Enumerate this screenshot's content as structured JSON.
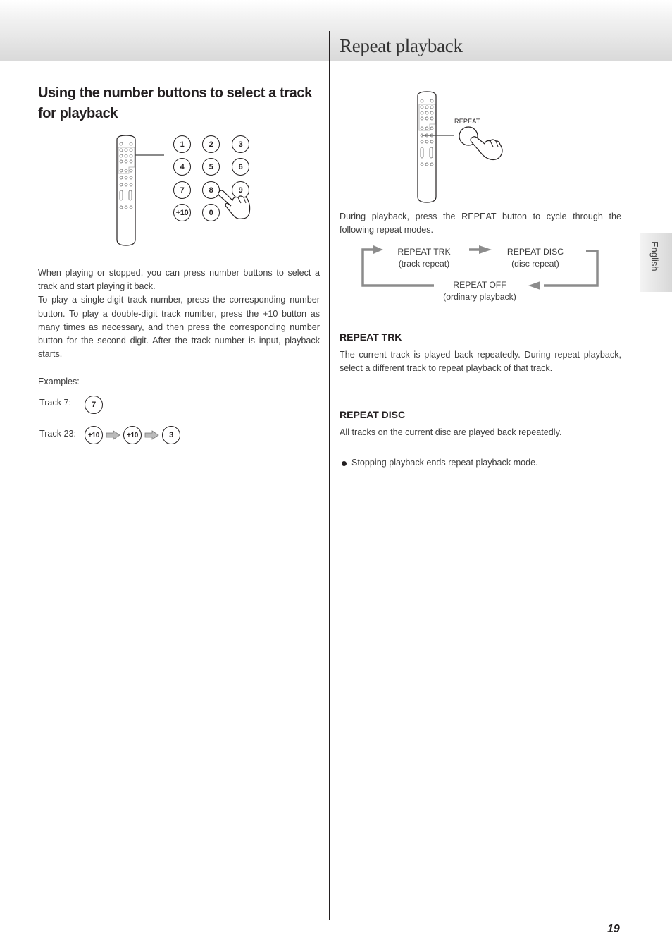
{
  "page": {
    "title": "Repeat playback",
    "page_number": "19",
    "language_tab": "English"
  },
  "left": {
    "heading": "Using the number buttons to select a track for playback",
    "keypad": [
      "1",
      "2",
      "3",
      "4",
      "5",
      "6",
      "7",
      "8",
      "9",
      "+10",
      "0"
    ],
    "paragraphs": [
      "When playing or stopped, you can press number buttons to select a track and start playing it back.",
      "To play a single-digit track number, press the corresponding number button. To play a double-digit track number, press the +10 button as many times as necessary, and then press the corresponding number button for the second digit. After the track number is input, playback starts."
    ],
    "examples_label": "Examples:",
    "examples": [
      {
        "label": "Track 7:",
        "buttons": [
          "7"
        ]
      },
      {
        "label": "Track 23:",
        "buttons": [
          "+10",
          "+10",
          "3"
        ]
      }
    ]
  },
  "right": {
    "remote_button_label": "REPEAT",
    "intro": "During playback, press the REPEAT button to cycle through the following repeat modes.",
    "cycle": [
      {
        "mode": "REPEAT TRK",
        "desc": "(track repeat)"
      },
      {
        "mode": "REPEAT DISC",
        "desc": "(disc repeat)"
      },
      {
        "mode": "REPEAT OFF",
        "desc": "(ordinary playback)"
      }
    ],
    "sections": [
      {
        "heading": "REPEAT TRK",
        "text": "The current track is played back repeatedly. During repeat playback, select a different track to repeat playback of that track."
      },
      {
        "heading": "REPEAT DISC",
        "text": "All tracks on the current disc are played back repeatedly."
      }
    ],
    "notes": [
      "Stopping playback ends repeat playback mode."
    ]
  },
  "colors": {
    "text": "#3d3d3d",
    "heading": "#231f20",
    "arrow_gray": "#8c8c8c"
  }
}
